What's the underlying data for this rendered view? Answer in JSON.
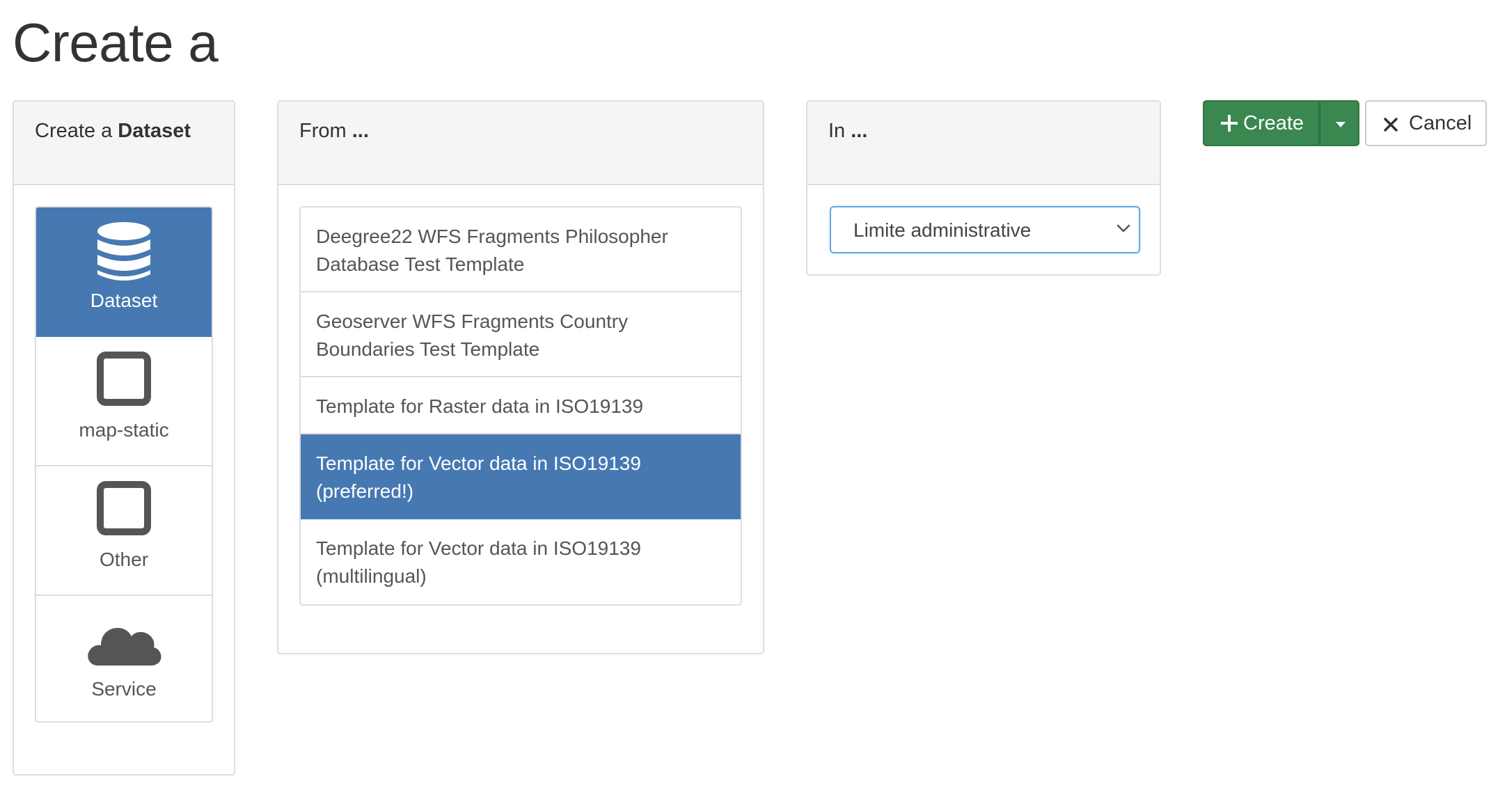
{
  "page": {
    "title": "Create a"
  },
  "type_panel": {
    "heading_prefix": "Create a",
    "heading_bold": "Dataset",
    "items": [
      {
        "label": "Dataset",
        "icon": "database-icon",
        "active": true
      },
      {
        "label": "map-static",
        "icon": "square-icon",
        "active": false
      },
      {
        "label": "Other",
        "icon": "square-icon",
        "active": false
      },
      {
        "label": "Service",
        "icon": "cloud-icon",
        "active": false
      }
    ]
  },
  "template_panel": {
    "heading_prefix": "From",
    "heading_bold": "...",
    "items": [
      {
        "line1": "Deegree22 WFS Fragments Philosopher",
        "line2": "Database Test Template",
        "active": false
      },
      {
        "line1": "Geoserver WFS Fragments Country",
        "line2": "Boundaries Test Template",
        "active": false
      },
      {
        "line1": "Template for Raster data in ISO19139",
        "line2": "",
        "active": false
      },
      {
        "line1": "Template for Vector data in ISO19139",
        "line2": "(preferred!)",
        "active": true
      },
      {
        "line1": "Template for Vector data in ISO19139",
        "line2": "(multilingual)",
        "active": false
      }
    ]
  },
  "group_panel": {
    "heading_prefix": "In",
    "heading_bold": "...",
    "selected": "Limite administrative"
  },
  "actions": {
    "create_label": "Create",
    "cancel_label": "Cancel"
  },
  "colors": {
    "active_blue": "#4679b2",
    "create_green": "#3a8750",
    "focus_border": "#66a8e6"
  }
}
